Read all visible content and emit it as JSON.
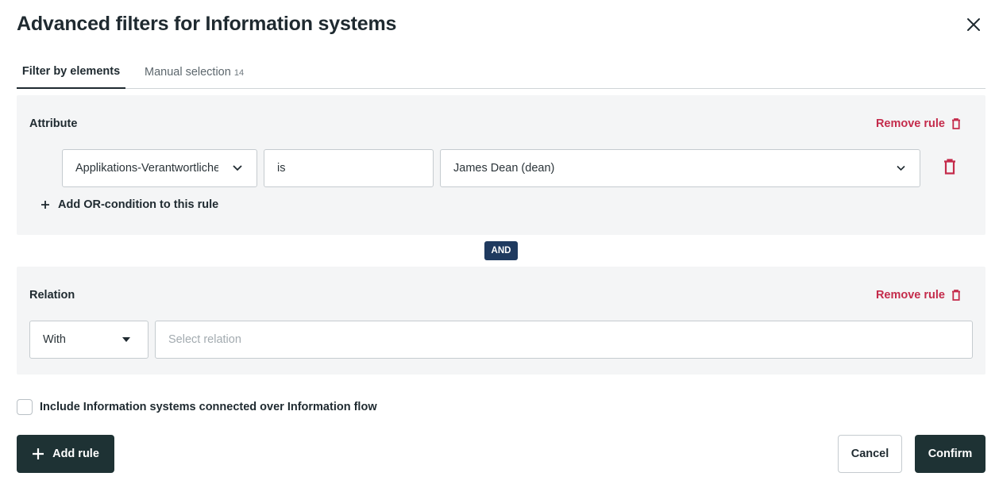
{
  "dialog": {
    "title": "Advanced filters for Information systems",
    "close_icon": "close-icon"
  },
  "tabs": [
    {
      "label": "Filter by elements",
      "active": true
    },
    {
      "label": "Manual selection",
      "count": "14",
      "active": false
    }
  ],
  "attribute_rule": {
    "title": "Attribute",
    "remove_label": "Remove rule",
    "attribute_value": "Applikations-Verantwortliche",
    "operator_value": "is",
    "value_value": "James Dean (dean)",
    "add_or_label": "Add OR-condition to this rule"
  },
  "connector": {
    "label": "AND"
  },
  "relation_rule": {
    "title": "Relation",
    "remove_label": "Remove rule",
    "with_value": "With",
    "relation_placeholder": "Select relation"
  },
  "include_option": {
    "label": "Include Information systems connected over Information flow",
    "checked": false
  },
  "footer": {
    "add_rule_label": "Add rule",
    "cancel_label": "Cancel",
    "confirm_label": "Confirm"
  },
  "colors": {
    "primary_dark": "#1e3234",
    "danger": "#c42b4b",
    "and_badge": "#1f3a5f",
    "panel_bg": "#f4f5f6"
  }
}
